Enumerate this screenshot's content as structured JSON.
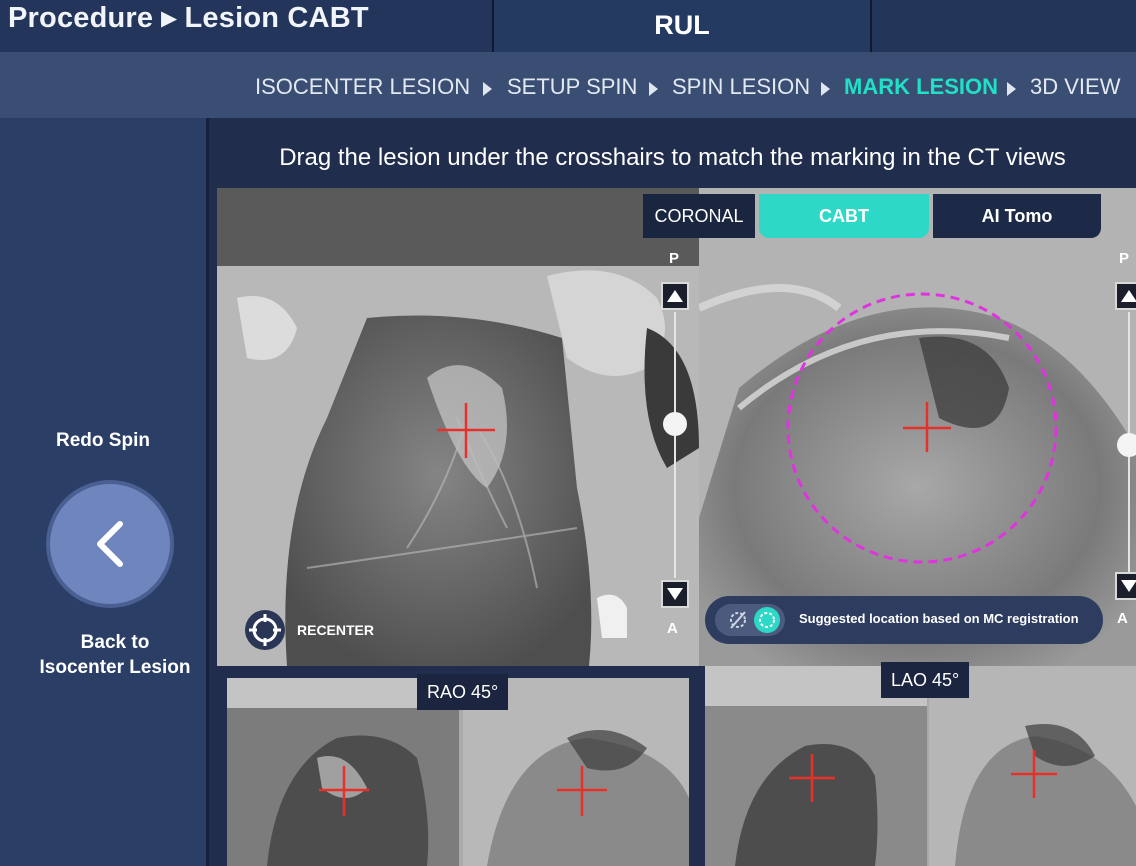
{
  "header": {
    "title": "Procedure ▸ Lesion CABT",
    "center_label": "RUL"
  },
  "steps": [
    {
      "label": "ISOCENTER LESION",
      "active": false
    },
    {
      "label": "SETUP SPIN",
      "active": false
    },
    {
      "label": "SPIN LESION",
      "active": false
    },
    {
      "label": "MARK LESION",
      "active": true
    },
    {
      "label": "3D VIEW",
      "active": false
    }
  ],
  "sidebar": {
    "redo_label": "Redo Spin",
    "back_label_line1": "Back to",
    "back_label_line2": "Isocenter Lesion"
  },
  "main": {
    "instruction": "Drag the lesion under the crosshairs to match the marking in the CT views"
  },
  "top_panel": {
    "plane_label": "CORONAL",
    "tabs": [
      {
        "label": "CABT",
        "selected": true
      },
      {
        "label": "AI Tomo",
        "selected": false
      }
    ],
    "recenter_label": "RECENTER",
    "suggest_label": "Suggested location based on MC registration",
    "left_slider": {
      "top_label": "P",
      "bottom_label": "A",
      "value": 0.42
    },
    "right_slider": {
      "top_label": "P",
      "bottom_label": "A",
      "value": 0.5
    }
  },
  "bottom_views": [
    {
      "label": "RAO 45°"
    },
    {
      "label": "LAO 45°"
    }
  ],
  "colors": {
    "accent": "#21e0c8",
    "tab_selected": "#2ed8c6",
    "crosshair": "#e8302a",
    "marking_circle": "#e033e0",
    "background": "#1a2744"
  }
}
